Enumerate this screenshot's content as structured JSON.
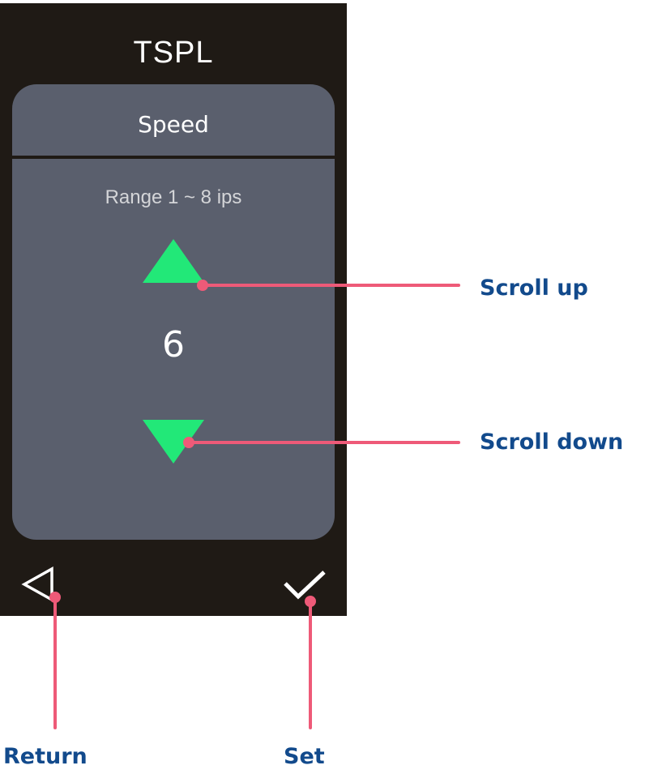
{
  "screen": {
    "title": "TSPL",
    "card": {
      "header": "Speed",
      "range_text": "Range 1 ~ 8 ips",
      "value": "6",
      "up_icon": "triangle-up-icon",
      "down_icon": "triangle-down-icon",
      "arrow_color": "#22e878"
    },
    "footer": {
      "return_icon": "triangle-left-outline-icon",
      "set_icon": "checkmark-icon"
    }
  },
  "callouts": {
    "scroll_up": "Scroll up",
    "scroll_down": "Scroll down",
    "return": "Return",
    "set": "Set",
    "line_color": "#ee5a78",
    "text_color": "#124a8c"
  },
  "colors": {
    "screen_bg": "#1f1a15",
    "card_bg": "#5a5f6d"
  }
}
